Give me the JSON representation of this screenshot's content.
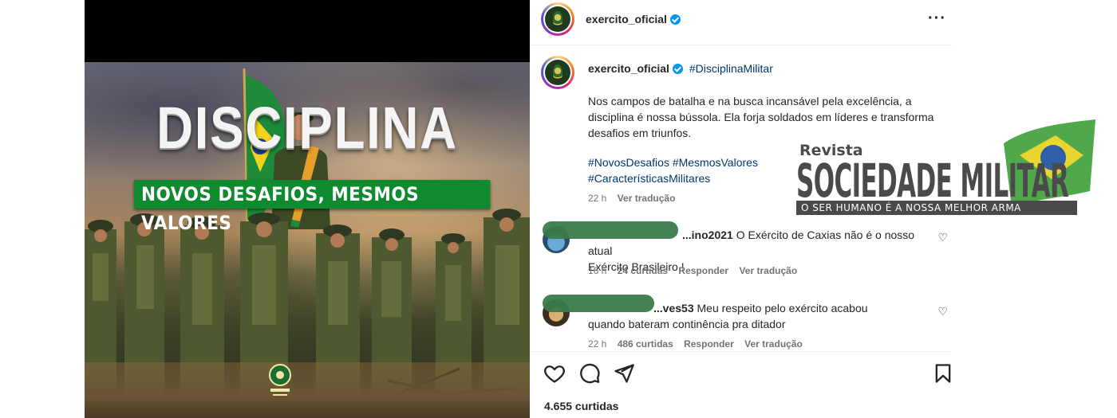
{
  "post_image": {
    "headline": "DISCIPLINA",
    "subheadline": "NOVOS DESAFIOS, MESMOS VALORES"
  },
  "header": {
    "username": "exercito_oficial",
    "more_icon": "more-horizontal-icon"
  },
  "caption": {
    "username": "exercito_oficial",
    "hashtag": "#DisciplinaMilitar",
    "text": "Nos campos de batalha e na busca incansável pela excelência, a disciplina é nossa bússola. Ela forja soldados em líderes e transforma desafios em triunfos.",
    "hashtags_line1": "#NovosDesafios #MesmosValores",
    "hashtags_line2": "#CaracterísticasMilitares",
    "time": "22 h",
    "translate": "Ver tradução"
  },
  "comments": [
    {
      "username": "...ino2021",
      "text": "O Exército de Caxias não é o nosso atual",
      "text2": "Exército Brasileiro !",
      "time": "16 h",
      "likes": "24 curtidas",
      "reply": "Responder",
      "translate": "Ver tradução"
    },
    {
      "username": "...ves53",
      "text": "Meu respeito pelo exército acabou",
      "text2": "quando bateram continência pra ditador",
      "time": "22 h",
      "likes": "486 curtidas",
      "reply": "Responder",
      "translate": "Ver tradução"
    }
  ],
  "actions": {
    "like_icon": "heart-icon",
    "comment_icon": "comment-icon",
    "share_icon": "send-icon",
    "save_icon": "bookmark-icon",
    "likes_count": "4.655 curtidas"
  },
  "watermark": {
    "revista": "Revista",
    "title": "SOCIEDADE MILITAR",
    "tagline": "O SER HUMANO É A NOSSA MELHOR ARMA"
  },
  "colors": {
    "verified": "#0095f6",
    "hashtag": "#00376b",
    "banner_green": "#0f8a2e"
  }
}
